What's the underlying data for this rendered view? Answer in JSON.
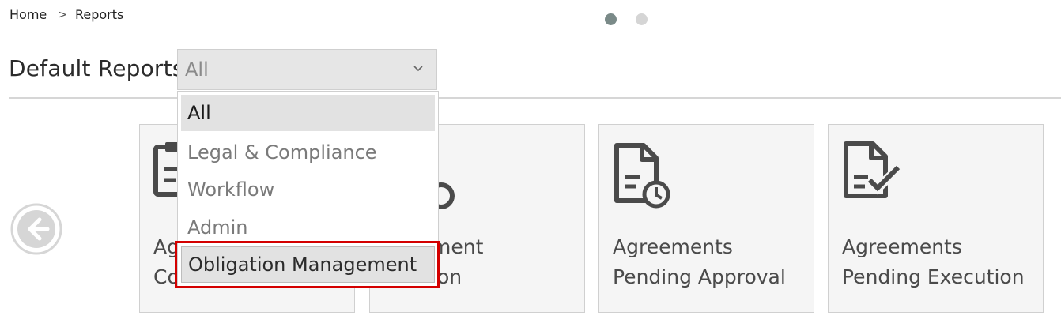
{
  "breadcrumb": {
    "home": "Home",
    "separator": ">",
    "current": "Reports"
  },
  "carousel": {
    "active_index": 0,
    "count": 2
  },
  "header": {
    "title": "Default Reports",
    "filter": {
      "selected_value": "All",
      "options": [
        "All",
        "Legal & Compliance",
        "Workflow",
        "Admin",
        "Obligation Management"
      ],
      "highlighted_option": "Obligation Management"
    }
  },
  "tiles": [
    {
      "line1": "Ag",
      "line2": "Co",
      "icon": "clipboard-report-icon"
    },
    {
      "line1": "ment",
      "line2": "ion",
      "icon": "document-clock-icon"
    },
    {
      "line1": "Agreements",
      "line2": "Pending Approval",
      "icon": "document-clock-icon"
    },
    {
      "line1": "Agreements",
      "line2": "Pending Execution",
      "icon": "document-check-icon"
    }
  ],
  "colors": {
    "highlight": "#d40000",
    "icon": "#4a4a4a"
  }
}
